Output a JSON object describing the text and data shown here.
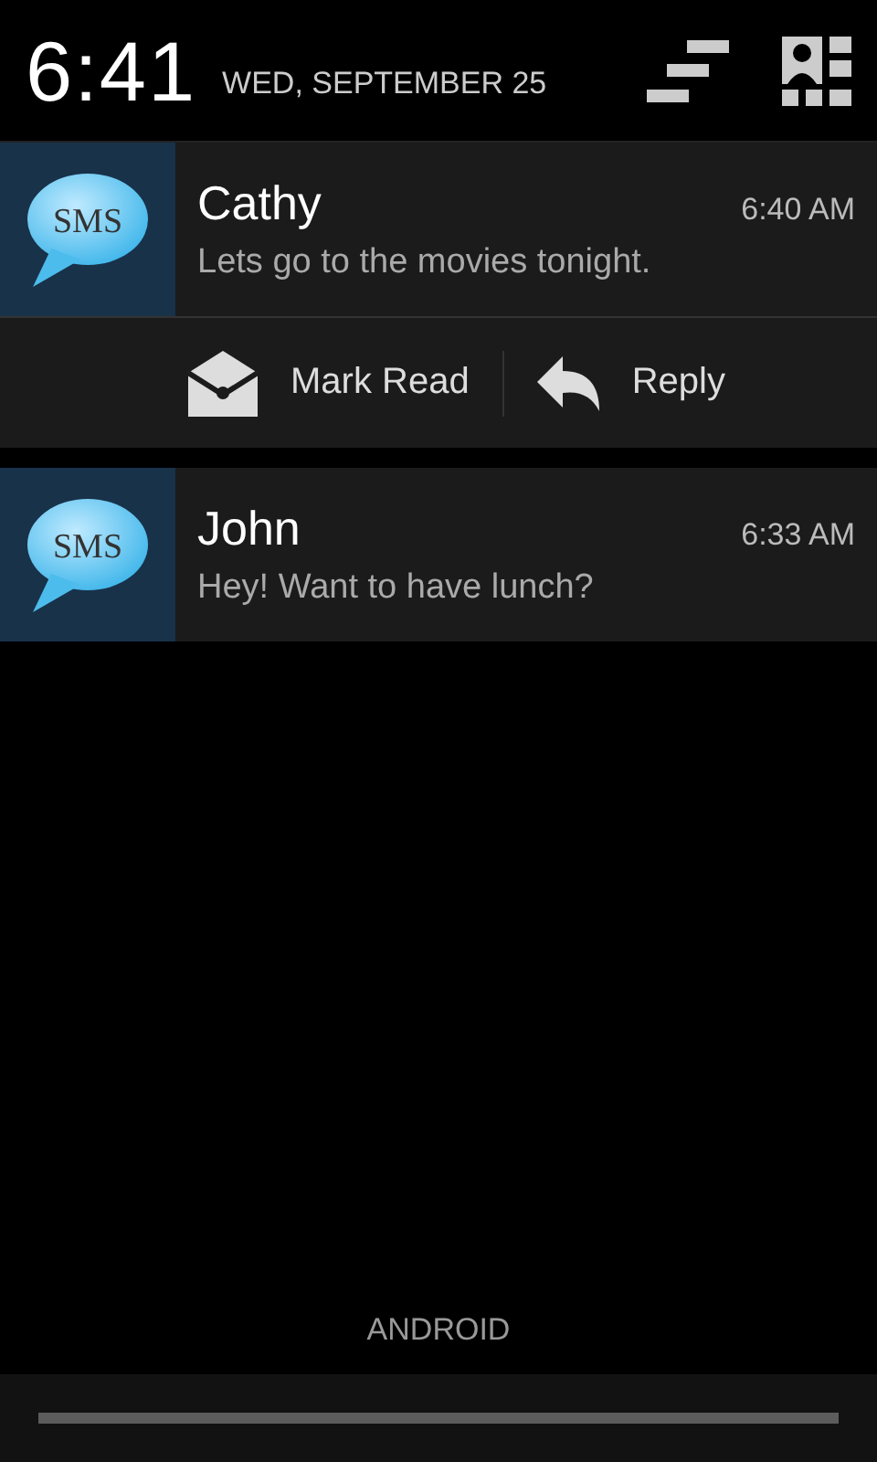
{
  "header": {
    "time": "6:41",
    "date": "WED, SEPTEMBER 25"
  },
  "notifications": [
    {
      "icon_text": "SMS",
      "sender": "Cathy",
      "time": "6:40 AM",
      "message": "Lets go to the movies tonight.",
      "actions": [
        {
          "kind": "mark_read",
          "label": "Mark Read"
        },
        {
          "kind": "reply",
          "label": "Reply"
        }
      ]
    },
    {
      "icon_text": "SMS",
      "sender": "John",
      "time": "6:33 AM",
      "message": "Hey! Want to have lunch?"
    }
  ],
  "carrier": "ANDROID"
}
